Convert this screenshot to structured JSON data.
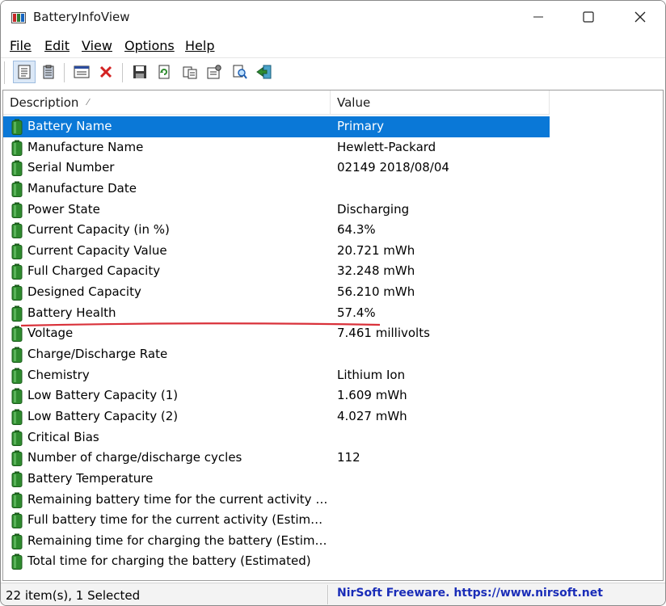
{
  "window": {
    "title": "BatteryInfoView"
  },
  "menu": [
    {
      "label": "File"
    },
    {
      "label": "Edit"
    },
    {
      "label": "View"
    },
    {
      "label": "Options"
    },
    {
      "label": "Help"
    }
  ],
  "toolbar": {
    "buttons": [
      "properties-icon",
      "clipboard-icon",
      "window-icon",
      "delete-icon",
      "save-icon",
      "refresh-icon",
      "copy-icon",
      "options-icon",
      "find-icon",
      "exit-icon"
    ]
  },
  "columns": {
    "description": "Description",
    "value": "Value",
    "sort_indicator": "⁄"
  },
  "rows": [
    {
      "description": "Battery Name",
      "value": "Primary",
      "selected": true
    },
    {
      "description": "Manufacture Name",
      "value": "Hewlett-Packard"
    },
    {
      "description": "Serial Number",
      "value": "02149 2018/08/04"
    },
    {
      "description": "Manufacture Date",
      "value": ""
    },
    {
      "description": "Power State",
      "value": "Discharging"
    },
    {
      "description": "Current Capacity (in %)",
      "value": "64.3%"
    },
    {
      "description": "Current Capacity Value",
      "value": "20.721 mWh"
    },
    {
      "description": "Full Charged Capacity",
      "value": "32.248 mWh"
    },
    {
      "description": "Designed Capacity",
      "value": "56.210 mWh"
    },
    {
      "description": "Battery Health",
      "value": "57.4%"
    },
    {
      "description": "Voltage",
      "value": "7.461 millivolts"
    },
    {
      "description": "Charge/Discharge Rate",
      "value": ""
    },
    {
      "description": "Chemistry",
      "value": "Lithium Ion"
    },
    {
      "description": "Low Battery Capacity (1)",
      "value": "1.609 mWh"
    },
    {
      "description": "Low Battery Capacity (2)",
      "value": "4.027 mWh"
    },
    {
      "description": "Critical Bias",
      "value": ""
    },
    {
      "description": "Number of charge/discharge cycles",
      "value": "112"
    },
    {
      "description": "Battery Temperature",
      "value": ""
    },
    {
      "description": "Remaining battery time for the current activity (Est...",
      "value": ""
    },
    {
      "description": "Full battery time for the current activity (Estimated)",
      "value": ""
    },
    {
      "description": "Remaining time for charging the battery (Estimated)",
      "value": ""
    },
    {
      "description": "Total  time for charging the battery (Estimated)",
      "value": ""
    }
  ],
  "status": {
    "items": "22 item(s), 1 Selected",
    "credit": "NirSoft Freeware. https://www.nirsoft.net"
  },
  "colors": {
    "selection": "#0a78d7",
    "battery_icon": "#2e8b2e",
    "annotation": "#d9313a",
    "credit_text": "#1a2db8"
  }
}
